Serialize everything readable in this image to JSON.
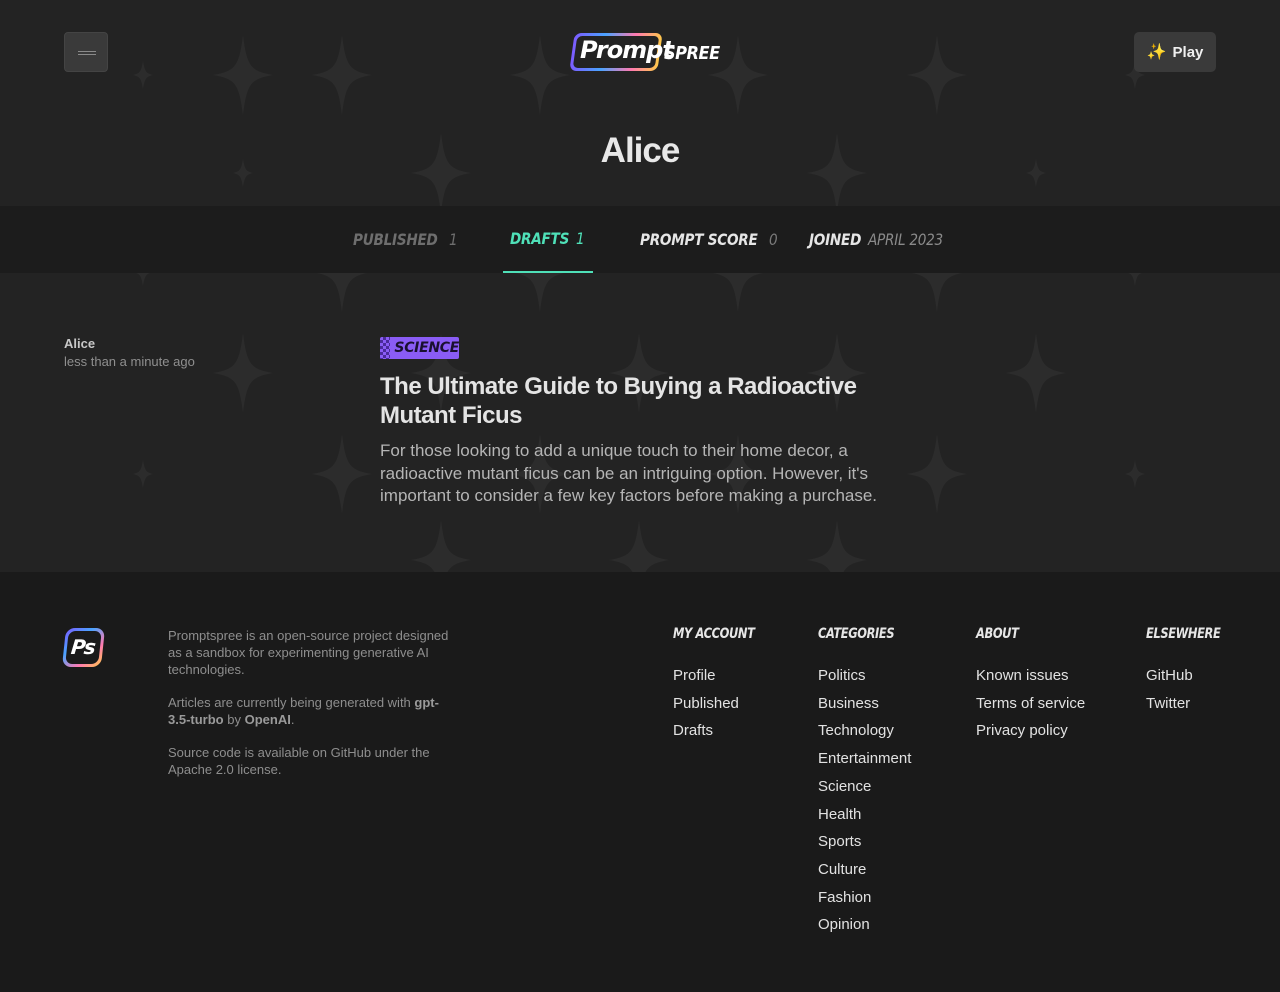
{
  "header": {
    "menu_icon": "hamburger-icon",
    "logo_prompt": "Prompt",
    "logo_spree": "SPREE",
    "play_label": "Play",
    "play_icon": "sparkles-icon"
  },
  "profile": {
    "name": "Alice"
  },
  "tabs": {
    "published": {
      "label": "Published",
      "value": "1"
    },
    "drafts": {
      "label": "Drafts",
      "value": "1"
    },
    "prompt_score": {
      "label": "Prompt Score",
      "value": "0"
    },
    "joined": {
      "label": "Joined",
      "value": "April 2023"
    }
  },
  "active_tab": "drafts",
  "article": {
    "author": "Alice",
    "time": "less than a minute ago",
    "category": "Science",
    "title": "The Ultimate Guide to Buying a Radioactive Mutant Ficus",
    "excerpt": "For those looking to add a unique touch to their home decor, a radioactive mutant ficus can be an intriguing option. However, it's important to consider a few key factors before making a purchase."
  },
  "footer": {
    "logo_text": "Ps",
    "about_1": "Promptspree is an open-source project designed as a sandbox for experimenting generative AI technologies.",
    "about_2_pre": "Articles are currently being generated with ",
    "about_2_model": "gpt-3.5-turbo",
    "about_2_mid": " by ",
    "about_2_org": "OpenAI",
    "about_2_post": ".",
    "about_3": "Source code is available on GitHub under the Apache 2.0 license.",
    "columns": {
      "account": {
        "title": "My Account",
        "links": [
          "Profile",
          "Published",
          "Drafts"
        ]
      },
      "categories": {
        "title": "Categories",
        "links": [
          "Politics",
          "Business",
          "Technology",
          "Entertainment",
          "Science",
          "Health",
          "Sports",
          "Culture",
          "Fashion",
          "Opinion"
        ]
      },
      "about": {
        "title": "About",
        "links": [
          "Known issues",
          "Terms of service",
          "Privacy policy"
        ]
      },
      "elsewhere": {
        "title": "Elsewhere",
        "links": [
          "GitHub",
          "Twitter"
        ]
      }
    }
  },
  "colors": {
    "background": "#232323",
    "tabbar": "#1c1c1c",
    "footer": "#1a1a1a",
    "accent_active": "#4fe0b8",
    "category_badge": "#8a5cf5"
  }
}
